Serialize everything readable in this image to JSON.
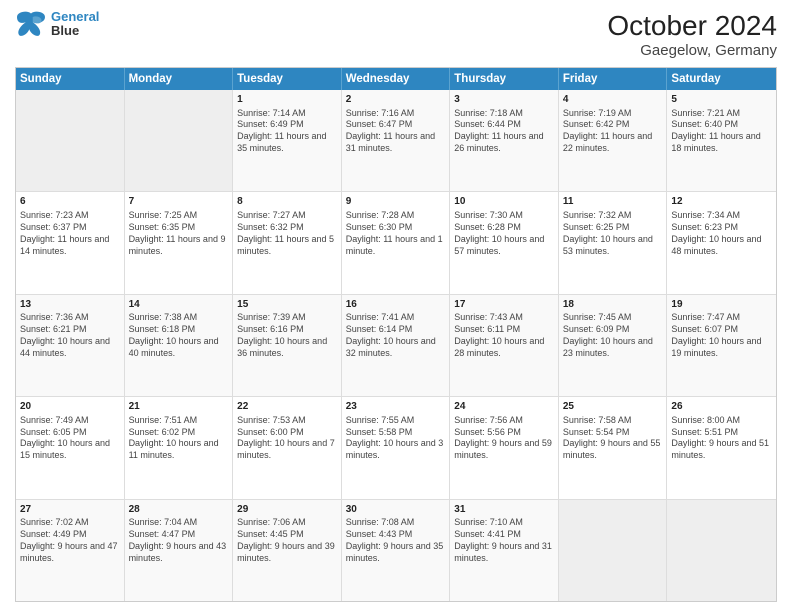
{
  "logo": {
    "line1": "General",
    "line2": "Blue"
  },
  "title": "October 2024",
  "subtitle": "Gaegelow, Germany",
  "header_days": [
    "Sunday",
    "Monday",
    "Tuesday",
    "Wednesday",
    "Thursday",
    "Friday",
    "Saturday"
  ],
  "weeks": [
    [
      {
        "day": "",
        "sunrise": "",
        "sunset": "",
        "daylight": "",
        "empty": true
      },
      {
        "day": "",
        "sunrise": "",
        "sunset": "",
        "daylight": "",
        "empty": true
      },
      {
        "day": "1",
        "sunrise": "Sunrise: 7:14 AM",
        "sunset": "Sunset: 6:49 PM",
        "daylight": "Daylight: 11 hours and 35 minutes."
      },
      {
        "day": "2",
        "sunrise": "Sunrise: 7:16 AM",
        "sunset": "Sunset: 6:47 PM",
        "daylight": "Daylight: 11 hours and 31 minutes."
      },
      {
        "day": "3",
        "sunrise": "Sunrise: 7:18 AM",
        "sunset": "Sunset: 6:44 PM",
        "daylight": "Daylight: 11 hours and 26 minutes."
      },
      {
        "day": "4",
        "sunrise": "Sunrise: 7:19 AM",
        "sunset": "Sunset: 6:42 PM",
        "daylight": "Daylight: 11 hours and 22 minutes."
      },
      {
        "day": "5",
        "sunrise": "Sunrise: 7:21 AM",
        "sunset": "Sunset: 6:40 PM",
        "daylight": "Daylight: 11 hours and 18 minutes."
      }
    ],
    [
      {
        "day": "6",
        "sunrise": "Sunrise: 7:23 AM",
        "sunset": "Sunset: 6:37 PM",
        "daylight": "Daylight: 11 hours and 14 minutes."
      },
      {
        "day": "7",
        "sunrise": "Sunrise: 7:25 AM",
        "sunset": "Sunset: 6:35 PM",
        "daylight": "Daylight: 11 hours and 9 minutes."
      },
      {
        "day": "8",
        "sunrise": "Sunrise: 7:27 AM",
        "sunset": "Sunset: 6:32 PM",
        "daylight": "Daylight: 11 hours and 5 minutes."
      },
      {
        "day": "9",
        "sunrise": "Sunrise: 7:28 AM",
        "sunset": "Sunset: 6:30 PM",
        "daylight": "Daylight: 11 hours and 1 minute."
      },
      {
        "day": "10",
        "sunrise": "Sunrise: 7:30 AM",
        "sunset": "Sunset: 6:28 PM",
        "daylight": "Daylight: 10 hours and 57 minutes."
      },
      {
        "day": "11",
        "sunrise": "Sunrise: 7:32 AM",
        "sunset": "Sunset: 6:25 PM",
        "daylight": "Daylight: 10 hours and 53 minutes."
      },
      {
        "day": "12",
        "sunrise": "Sunrise: 7:34 AM",
        "sunset": "Sunset: 6:23 PM",
        "daylight": "Daylight: 10 hours and 48 minutes."
      }
    ],
    [
      {
        "day": "13",
        "sunrise": "Sunrise: 7:36 AM",
        "sunset": "Sunset: 6:21 PM",
        "daylight": "Daylight: 10 hours and 44 minutes."
      },
      {
        "day": "14",
        "sunrise": "Sunrise: 7:38 AM",
        "sunset": "Sunset: 6:18 PM",
        "daylight": "Daylight: 10 hours and 40 minutes."
      },
      {
        "day": "15",
        "sunrise": "Sunrise: 7:39 AM",
        "sunset": "Sunset: 6:16 PM",
        "daylight": "Daylight: 10 hours and 36 minutes."
      },
      {
        "day": "16",
        "sunrise": "Sunrise: 7:41 AM",
        "sunset": "Sunset: 6:14 PM",
        "daylight": "Daylight: 10 hours and 32 minutes."
      },
      {
        "day": "17",
        "sunrise": "Sunrise: 7:43 AM",
        "sunset": "Sunset: 6:11 PM",
        "daylight": "Daylight: 10 hours and 28 minutes."
      },
      {
        "day": "18",
        "sunrise": "Sunrise: 7:45 AM",
        "sunset": "Sunset: 6:09 PM",
        "daylight": "Daylight: 10 hours and 23 minutes."
      },
      {
        "day": "19",
        "sunrise": "Sunrise: 7:47 AM",
        "sunset": "Sunset: 6:07 PM",
        "daylight": "Daylight: 10 hours and 19 minutes."
      }
    ],
    [
      {
        "day": "20",
        "sunrise": "Sunrise: 7:49 AM",
        "sunset": "Sunset: 6:05 PM",
        "daylight": "Daylight: 10 hours and 15 minutes."
      },
      {
        "day": "21",
        "sunrise": "Sunrise: 7:51 AM",
        "sunset": "Sunset: 6:02 PM",
        "daylight": "Daylight: 10 hours and 11 minutes."
      },
      {
        "day": "22",
        "sunrise": "Sunrise: 7:53 AM",
        "sunset": "Sunset: 6:00 PM",
        "daylight": "Daylight: 10 hours and 7 minutes."
      },
      {
        "day": "23",
        "sunrise": "Sunrise: 7:55 AM",
        "sunset": "Sunset: 5:58 PM",
        "daylight": "Daylight: 10 hours and 3 minutes."
      },
      {
        "day": "24",
        "sunrise": "Sunrise: 7:56 AM",
        "sunset": "Sunset: 5:56 PM",
        "daylight": "Daylight: 9 hours and 59 minutes."
      },
      {
        "day": "25",
        "sunrise": "Sunrise: 7:58 AM",
        "sunset": "Sunset: 5:54 PM",
        "daylight": "Daylight: 9 hours and 55 minutes."
      },
      {
        "day": "26",
        "sunrise": "Sunrise: 8:00 AM",
        "sunset": "Sunset: 5:51 PM",
        "daylight": "Daylight: 9 hours and 51 minutes."
      }
    ],
    [
      {
        "day": "27",
        "sunrise": "Sunrise: 7:02 AM",
        "sunset": "Sunset: 4:49 PM",
        "daylight": "Daylight: 9 hours and 47 minutes."
      },
      {
        "day": "28",
        "sunrise": "Sunrise: 7:04 AM",
        "sunset": "Sunset: 4:47 PM",
        "daylight": "Daylight: 9 hours and 43 minutes."
      },
      {
        "day": "29",
        "sunrise": "Sunrise: 7:06 AM",
        "sunset": "Sunset: 4:45 PM",
        "daylight": "Daylight: 9 hours and 39 minutes."
      },
      {
        "day": "30",
        "sunrise": "Sunrise: 7:08 AM",
        "sunset": "Sunset: 4:43 PM",
        "daylight": "Daylight: 9 hours and 35 minutes."
      },
      {
        "day": "31",
        "sunrise": "Sunrise: 7:10 AM",
        "sunset": "Sunset: 4:41 PM",
        "daylight": "Daylight: 9 hours and 31 minutes."
      },
      {
        "day": "",
        "sunrise": "",
        "sunset": "",
        "daylight": "",
        "empty": true
      },
      {
        "day": "",
        "sunrise": "",
        "sunset": "",
        "daylight": "",
        "empty": true
      }
    ]
  ]
}
